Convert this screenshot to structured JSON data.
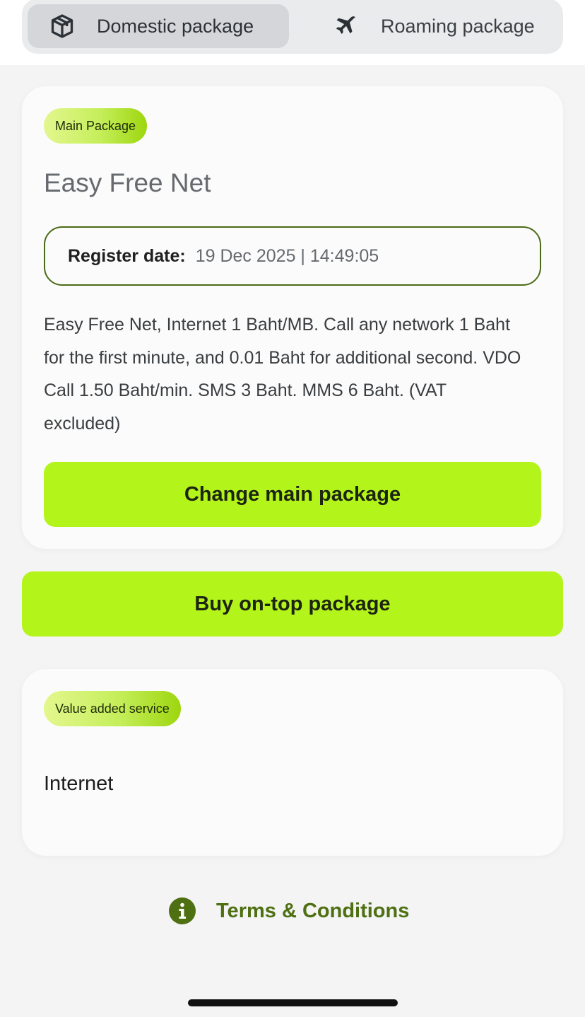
{
  "tabs": {
    "domestic": {
      "label": "Domestic package",
      "icon": "package-box-icon"
    },
    "roaming": {
      "label": "Roaming package",
      "icon": "airplane-icon"
    },
    "active": "domestic"
  },
  "main_package": {
    "badge": "Main Package",
    "name": "Easy Free Net",
    "register_label": "Register date:",
    "register_value": "19 Dec 2025 | 14:49:05",
    "description": "Easy Free Net, Internet 1 Baht/MB. Call any network 1 Baht for the first minute, and 0.01 Baht for additional second. VDO Call 1.50 Baht/min. SMS 3 Baht. MMS 6 Baht. (VAT excluded)",
    "change_button": "Change main package"
  },
  "on_top": {
    "button": "Buy on-top package"
  },
  "value_added": {
    "badge": "Value added service",
    "items": [
      "Internet"
    ]
  },
  "terms": {
    "label": "Terms & Conditions",
    "icon": "info-icon"
  },
  "colors": {
    "accent_green": "#b3f51b",
    "terms_green": "#4e6f12",
    "border_green": "#4b6a17"
  }
}
